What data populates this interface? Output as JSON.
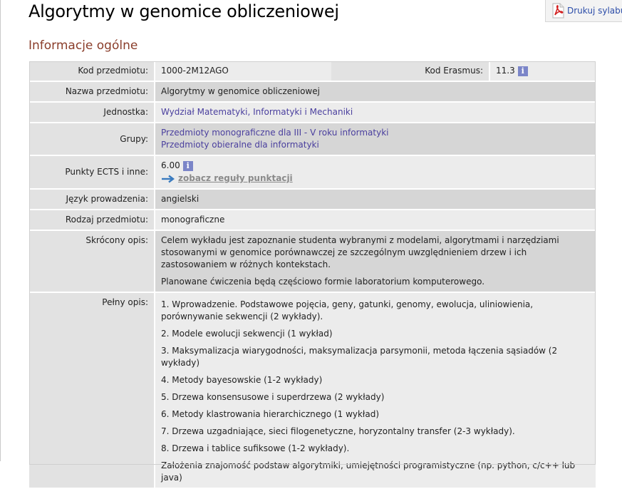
{
  "page": {
    "title": "Algorytmy w genomice obliczeniowej",
    "section_heading": "Informacje ogólne",
    "print_label": "Drukuj sylabus"
  },
  "icons": {
    "print": "pdf-icon",
    "info": "info-icon",
    "arrow": "arrow-right-icon"
  },
  "colors": {
    "section_heading": "#8a3d2a",
    "link": "#4a3f9e",
    "info_badge": "#7b85c8"
  },
  "info": {
    "kod_label": "Kod przedmiotu:",
    "kod_value": "1000-2M12AGO",
    "erasmus_label": "Kod Erasmus:",
    "erasmus_value": "11.3",
    "nazwa_label": "Nazwa przedmiotu:",
    "nazwa_value": "Algorytmy w genomice obliczeniowej",
    "jednostka_label": "Jednostka:",
    "jednostka_value": "Wydział Matematyki, Informatyki i Mechaniki",
    "grupy_label": "Grupy:",
    "grupy_items": [
      "Przedmioty monograficzne dla III - V roku informatyki",
      "Przedmioty obieralne dla informatyki"
    ],
    "ects_label": "Punkty ECTS i inne:",
    "ects_value": "6.00",
    "ects_rules_link": "zobacz reguły punktacji",
    "jezyk_label": "Język prowadzenia:",
    "jezyk_value": "angielski",
    "rodzaj_label": "Rodzaj przedmiotu:",
    "rodzaj_value": "monograficzne",
    "skrocony_label": "Skrócony opis:",
    "skrocony_paragraphs": [
      "Celem wykładu jest zapoznanie studenta wybranymi z modelami, algorytmami i narzędziami stosowanymi w genomice porównawczej ze szczególnym uwzględnieniem drzew i ich zastosowaniem w różnych kontekstach.",
      "Planowane ćwiczenia będą częściowo formie laboratorium komputerowego."
    ],
    "pelny_label": "Pełny opis:",
    "pelny_paragraphs": [
      "1. Wprowadzenie. Podstawowe pojęcia, geny, gatunki, genomy, ewolucja, uliniowienia, porównywanie sekwencji (2 wykłady).",
      "2. Modele ewolucji sekwencji (1 wykład)",
      "3. Maksymalizacja wiarygodności, maksymalizacja parsymonii, metoda łączenia sąsiadów (2 wykłady)",
      "4. Metody bayesowskie (1-2 wykłady)",
      "5. Drzewa konsensusowe i superdrzewa (2 wykłady)",
      "6. Metody klastrowania hierarchicznego (1 wykład)",
      "7. Drzewa uzgadniające, sieci filogenetyczne, horyzontalny transfer (2-3 wykłady).",
      "8. Drzewa i tablice sufiksowe (1-2 wykłady).",
      "Założenia znajomość podstaw algorytmiki, umiejętności programistyczne (np. python, c/c++ lub java)"
    ]
  }
}
